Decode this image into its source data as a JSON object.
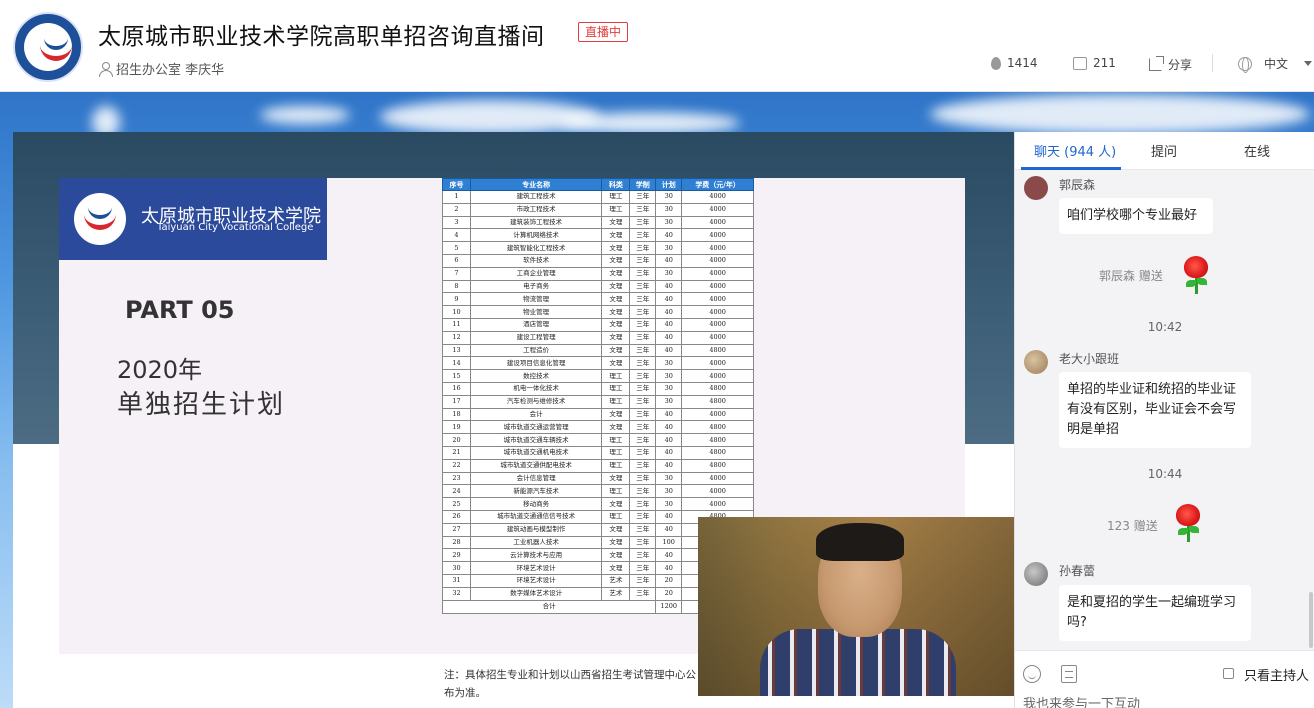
{
  "header": {
    "title": "太原城市职业技术学院高职单招咨询直播间",
    "live_badge": "直播中",
    "host": "招生办公室 李庆华",
    "views": "1414",
    "likes": "211",
    "share": "分享",
    "language": "中文"
  },
  "slide": {
    "college_cn": "太原城市职业技术学院",
    "college_en": "Taiyuan City Vocational College",
    "part": "PART 05",
    "year": "2020年",
    "plan_title": "单独招生计划",
    "table": {
      "headers": [
        "序号",
        "专业名称",
        "科类",
        "学制",
        "计划",
        "学费（元/年）"
      ],
      "rows": [
        [
          "1",
          "建筑工程技术",
          "理工",
          "三年",
          "30",
          "4000"
        ],
        [
          "2",
          "市政工程技术",
          "理工",
          "三年",
          "30",
          "4000"
        ],
        [
          "3",
          "建筑装饰工程技术",
          "文理",
          "三年",
          "30",
          "4000"
        ],
        [
          "4",
          "计算机网络技术",
          "文理",
          "三年",
          "40",
          "4000"
        ],
        [
          "5",
          "建筑智能化工程技术",
          "文理",
          "三年",
          "30",
          "4000"
        ],
        [
          "6",
          "软件技术",
          "文理",
          "三年",
          "40",
          "4000"
        ],
        [
          "7",
          "工商企业管理",
          "文理",
          "三年",
          "30",
          "4000"
        ],
        [
          "8",
          "电子商务",
          "文理",
          "三年",
          "40",
          "4000"
        ],
        [
          "9",
          "物流管理",
          "文理",
          "三年",
          "40",
          "4000"
        ],
        [
          "10",
          "物业管理",
          "文理",
          "三年",
          "40",
          "4000"
        ],
        [
          "11",
          "酒店管理",
          "文理",
          "三年",
          "40",
          "4000"
        ],
        [
          "12",
          "建设工程管理",
          "文理",
          "三年",
          "40",
          "4000"
        ],
        [
          "13",
          "工程造价",
          "文理",
          "三年",
          "40",
          "4800"
        ],
        [
          "14",
          "建设项目信息化管理",
          "文理",
          "三年",
          "30",
          "4000"
        ],
        [
          "15",
          "数控技术",
          "理工",
          "三年",
          "30",
          "4000"
        ],
        [
          "16",
          "机电一体化技术",
          "理工",
          "三年",
          "30",
          "4800"
        ],
        [
          "17",
          "汽车检测与维修技术",
          "理工",
          "三年",
          "30",
          "4800"
        ],
        [
          "18",
          "会计",
          "文理",
          "三年",
          "40",
          "4000"
        ],
        [
          "19",
          "城市轨道交通运营管理",
          "文理",
          "三年",
          "40",
          "4800"
        ],
        [
          "20",
          "城市轨道交通车辆技术",
          "理工",
          "三年",
          "40",
          "4800"
        ],
        [
          "21",
          "城市轨道交通机电技术",
          "理工",
          "三年",
          "40",
          "4800"
        ],
        [
          "22",
          "城市轨道交通供配电技术",
          "理工",
          "三年",
          "40",
          "4800"
        ],
        [
          "23",
          "会计信息管理",
          "文理",
          "三年",
          "30",
          "4000"
        ],
        [
          "24",
          "新能源汽车技术",
          "理工",
          "三年",
          "30",
          "4000"
        ],
        [
          "25",
          "移动商务",
          "文理",
          "三年",
          "30",
          "4000"
        ],
        [
          "26",
          "城市轨道交通通信信号技术",
          "理工",
          "三年",
          "40",
          "4800"
        ],
        [
          "27",
          "建筑动画与模型制作",
          "文理",
          "三年",
          "40",
          ""
        ],
        [
          "28",
          "工业机器人技术",
          "文理",
          "三年",
          "100",
          ""
        ],
        [
          "29",
          "云计算技术与应用",
          "文理",
          "三年",
          "40",
          ""
        ],
        [
          "30",
          "环境艺术设计",
          "文理",
          "三年",
          "40",
          ""
        ],
        [
          "31",
          "环境艺术设计",
          "艺术",
          "三年",
          "20",
          ""
        ],
        [
          "32",
          "数字媒体艺术设计",
          "艺术",
          "三年",
          "20",
          ""
        ]
      ],
      "total_label": "合计",
      "total_value": "1200"
    },
    "note": "注：具体招生专业和计划以山西省招生考试管理中心公布为准。"
  },
  "chat": {
    "tabs": [
      "聊天 (944 人)",
      "提问",
      "在线"
    ],
    "messages": [
      {
        "user": "郭辰森",
        "text": "咱们学校哪个专业最好"
      },
      {
        "user": "老大小跟班",
        "text": "单招的毕业证和统招的毕业证有没有区别，毕业证会不会写明是单招"
      },
      {
        "user": "孙春蕾",
        "text": "是和夏招的学生一起编班学习吗?"
      }
    ],
    "gifts": [
      "郭辰森 赠送",
      "123 赠送"
    ],
    "times": [
      "10:42",
      "10:44"
    ],
    "host_only": "只看主持人",
    "input_placeholder": "我也来参与一下互动"
  },
  "colors": {
    "accent": "#1f66d0",
    "live": "#e23d3d",
    "table_header": "#2f7fd2"
  }
}
